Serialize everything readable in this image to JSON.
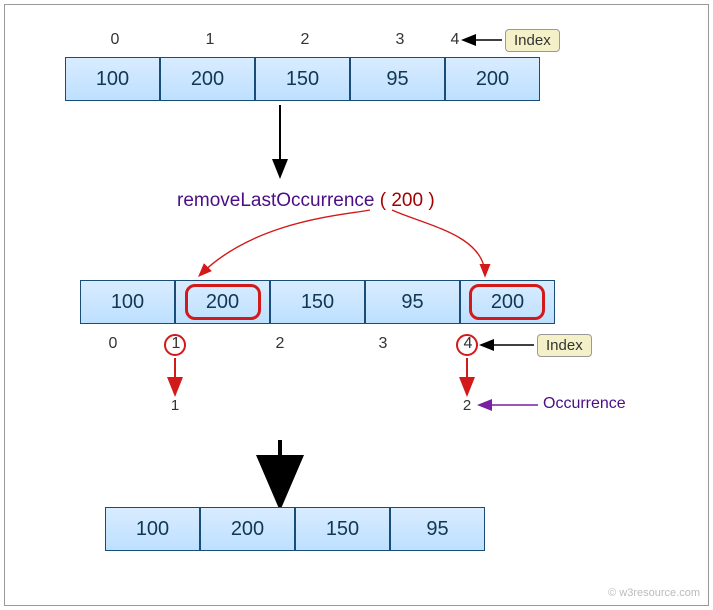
{
  "chart_data": {
    "type": "table",
    "initial_array": [
      100,
      200,
      150,
      95,
      200
    ],
    "initial_indices": [
      0,
      1,
      2,
      3,
      4
    ],
    "operation": {
      "method": "removeLastOccurrence",
      "argument": 200,
      "match_indices": [
        1,
        4
      ],
      "occurrences": [
        1,
        2
      ],
      "removed_index": 4
    },
    "result_array": [
      100,
      200,
      150,
      95
    ]
  },
  "labels": {
    "index": "Index",
    "occurrence": "Occurrence"
  },
  "method": {
    "name": "removeLastOccurrence",
    "open": "(",
    "close": ")",
    "arg": "200"
  },
  "row1": {
    "c0": "100",
    "c1": "200",
    "c2": "150",
    "c3": "95",
    "c4": "200"
  },
  "idx1": {
    "i0": "0",
    "i1": "1",
    "i2": "2",
    "i3": "3",
    "i4": "4"
  },
  "row2": {
    "c0": "100",
    "c1": "200",
    "c2": "150",
    "c3": "95",
    "c4": "200"
  },
  "idx2": {
    "i0": "0",
    "i1": "1",
    "i2": "2",
    "i3": "3",
    "i4": "4"
  },
  "occ": {
    "o1": "1",
    "o2": "2"
  },
  "row3": {
    "c0": "100",
    "c1": "200",
    "c2": "150",
    "c3": "95"
  },
  "attribution": "© w3resource.com"
}
